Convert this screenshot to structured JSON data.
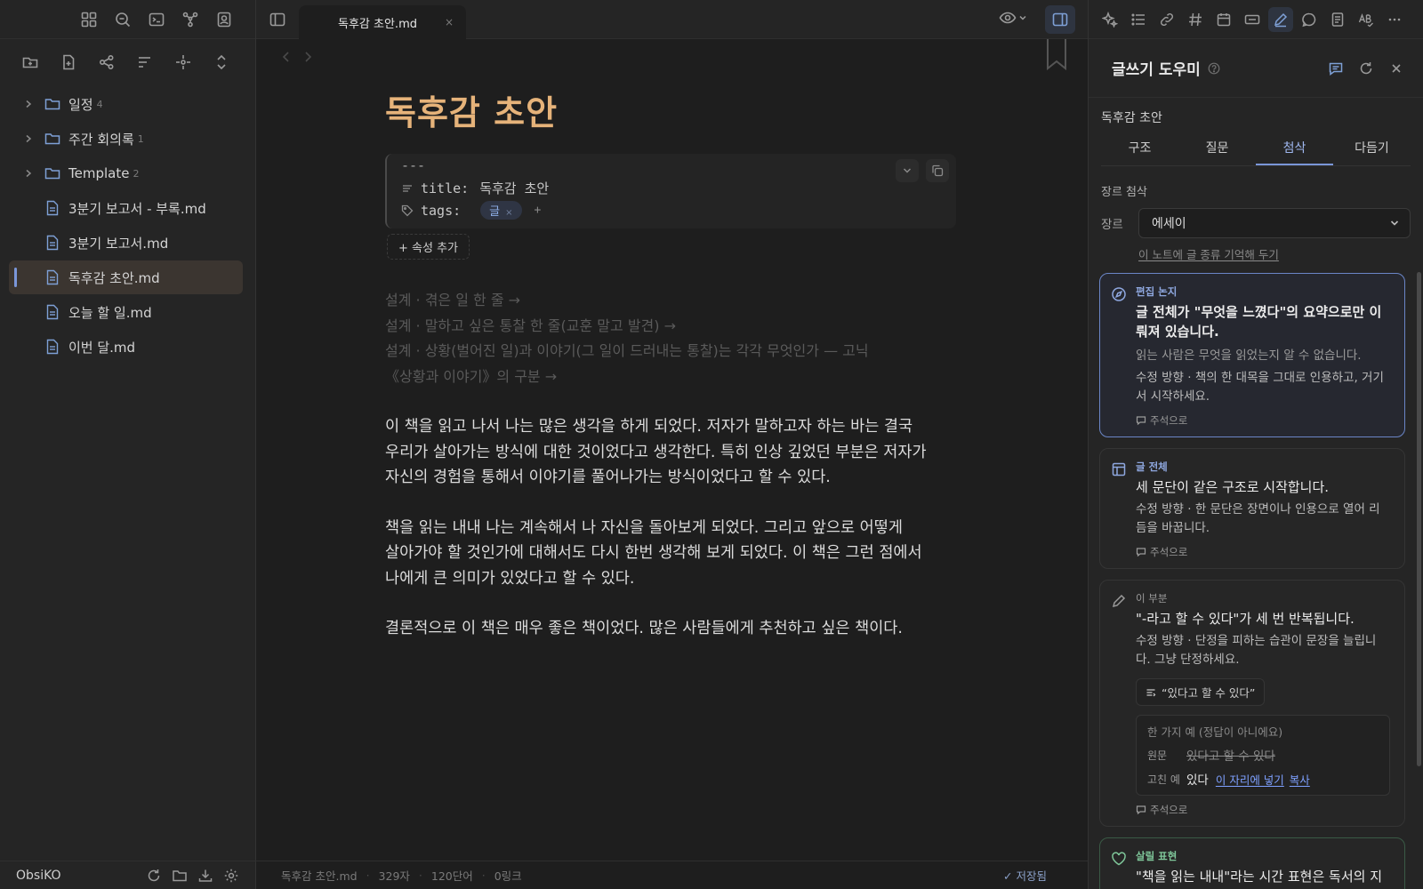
{
  "left_sidebar": {
    "ribbon_icons": [
      "layout-grid-icon",
      "search-file-icon",
      "terminal-icon",
      "graph-icon",
      "contact-icon"
    ],
    "toolbar_icons": [
      "new-folder-icon",
      "new-note-icon",
      "graph-view-icon",
      "sort-icon",
      "reveal-icon",
      "collapse-icon"
    ],
    "tree": [
      {
        "type": "folder",
        "name": "일정",
        "count": "4"
      },
      {
        "type": "folder",
        "name": "주간 회의록",
        "count": "1"
      },
      {
        "type": "folder",
        "name": "Template",
        "count": "2"
      },
      {
        "type": "file",
        "name": "3분기 보고서 - 부록.md"
      },
      {
        "type": "file",
        "name": "3분기 보고서.md"
      },
      {
        "type": "file",
        "name": "독후감 초안.md",
        "active": true
      },
      {
        "type": "file",
        "name": "오늘 할 일.md"
      },
      {
        "type": "file",
        "name": "이번 달.md"
      }
    ],
    "vault_name": "ObsiKO"
  },
  "editor": {
    "tab_title": "독후감 초안.md",
    "tab_close": "×",
    "doc_title": "독후감 초안",
    "frontmatter_delim": "---",
    "properties": {
      "title_key": "title:",
      "title_value": "독후감 초안",
      "tags_key": "tags:",
      "tag_value": "글",
      "tag_remove": "×",
      "tag_add": "+"
    },
    "add_property": "+ 속성 추가",
    "outline": [
      "설계 · 겪은 일 한 줄 →",
      "설계 · 말하고 싶은 통찰 한 줄(교훈 말고 발견) →",
      "설계 · 상황(벌어진 일)과 이야기(그 일이 드러내는 통찰)는 각각 무엇인가 — 고닉",
      "《상황과 이야기》의 구분 →"
    ],
    "paragraphs": [
      "이 책을 읽고 나서 나는 많은 생각을 하게 되었다. 저자가 말하고자 하는 바는 결국\n우리가 살아가는 방식에 대한 것이었다고 생각한다. 특히 인상 깊었던 부분은 저자가\n자신의 경험을 통해서 이야기를 풀어나가는 방식이었다고 할 수 있다.",
      "책을 읽는 내내 나는 계속해서 나 자신을 돌아보게 되었다. 그리고 앞으로 어떻게\n살아가야 할 것인가에 대해서도 다시 한번 생각해 보게 되었다. 이 책은 그런 점에서\n나에게 큰 의미가 있었다고 할 수 있다.",
      "결론적으로 이 책은 매우 좋은 책이었다. 많은 사람들에게 추천하고 싶은 책이다."
    ],
    "status": {
      "file": "독후감 초안.md",
      "chars": "329자",
      "words": "120단어",
      "links": "0링크",
      "saved": "✓ 저장됨"
    }
  },
  "right_sidebar": {
    "ribbon_icons": [
      "sparkle-icon",
      "list-icon",
      "link-icon",
      "hash-icon",
      "calendar-icon",
      "keyboard-icon",
      "pen-icon",
      "chat-icon",
      "note-icon",
      "spellcheck-icon",
      "more-icon"
    ],
    "title": "글쓰기 도우미",
    "note_name": "독후감 초안",
    "tabs": [
      "구조",
      "질문",
      "첨삭",
      "다듬기"
    ],
    "active_tab": 2,
    "genre_heading": "장르 첨삭",
    "genre_label": "장르",
    "genre_value": "에세이",
    "remember_link": "이 노트에 글 종류 기억해 두기",
    "cards": [
      {
        "tag": "편집 논지",
        "head": "글 전체가 \"무엇을 느꼈다\"의 요약으로만 이뤄져 있습니다.",
        "note": "읽는 사람은 무엇을 읽었는지 알 수 없습니다.",
        "fix": "수정 방향 · 책의 한 대목을 그대로 인용하고, 거기서 시작하세요.",
        "memo": "주석으로"
      },
      {
        "tag": "글 전체",
        "head": "세 문단이 같은 구조로 시작합니다.",
        "fix": "수정 방향 · 한 문단은 장면이나 인용으로 열어 리듬을 바꿉니다.",
        "memo": "주석으로"
      },
      {
        "tag": "이 부분",
        "head": "\"-라고 할 수 있다\"가 세 번 반복됩니다.",
        "fix": "수정 방향 · 단정을 피하는 습관이 문장을 늘립니다. 그냥 단정하세요.",
        "find_chip": "“있다고 할 수 있다”",
        "example": {
          "head": "한 가지 예 (정답이 아니에요)",
          "orig_label": "원문",
          "orig": "있다고 할 수 있다",
          "fix_label": "고친 예",
          "fix": "있다",
          "insert_link": "이 자리에 넣기",
          "copy_link": "복사"
        },
        "memo": "주석으로"
      },
      {
        "tag": "살릴 표현",
        "head": "\"책을 읽는 내내\"라는 시간 표현은 독서의 지속을 잘 담았습니다."
      }
    ]
  },
  "colors": {
    "accent": "#7a96d8",
    "title_orange": "#e6b37a",
    "good_green": "#7fc79a",
    "background": "#1e1e1e",
    "sidebar": "#252525"
  }
}
